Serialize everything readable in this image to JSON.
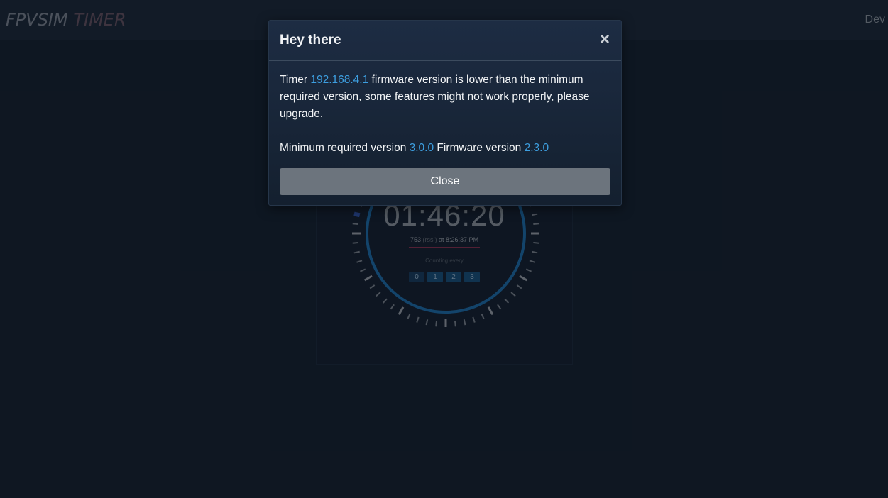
{
  "app": {
    "brand_part1": "FPVSIM",
    "brand_part2": "TIMER",
    "nav_dev": "Dev"
  },
  "timer": {
    "time": "01:46:20",
    "rssi_value": "753",
    "rssi_unit": "(rssi)",
    "at_label": "at",
    "timestamp": "8:26:37 PM",
    "counting_label": "Counting every",
    "counts": [
      "0",
      "1",
      "2",
      "3"
    ]
  },
  "modal": {
    "title": "Hey there",
    "close_symbol": "×",
    "msg_prefix": "Timer",
    "ip": "192.168.4.1",
    "msg_suffix": "firmware version is lower than the minimum required version, some features might not work properly, please upgrade.",
    "min_label": "Minimum required version",
    "min_version": "3.0.0",
    "fw_label": "Firmware version",
    "fw_version": "2.3.0",
    "close_button": "Close"
  },
  "colors": {
    "background": "#121c29",
    "accent": "#3d9fe0",
    "dial_ring": "#1a6299",
    "button_gray": "#6c747d"
  }
}
